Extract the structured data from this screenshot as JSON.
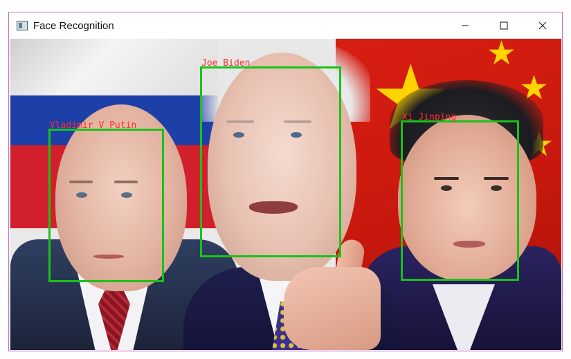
{
  "window": {
    "title": "Face Recognition",
    "icon": "app-window-icon",
    "controls": {
      "minimize_icon": "minimize-icon",
      "maximize_icon": "maximize-icon",
      "close_icon": "close-icon"
    }
  },
  "detections": [
    {
      "name": "Vladimir V Putin",
      "box_color": "#19c219",
      "label_color": "#ff2e2e"
    },
    {
      "name": "Joe Biden",
      "box_color": "#19c219",
      "label_color": "#ff2e2e"
    },
    {
      "name": "Xi Jinping",
      "box_color": "#19c219",
      "label_color": "#ff2e2e"
    }
  ],
  "colors": {
    "window_border": "#c86fc8",
    "detection_box": "#19c219",
    "detection_label": "#ff2e2e"
  }
}
